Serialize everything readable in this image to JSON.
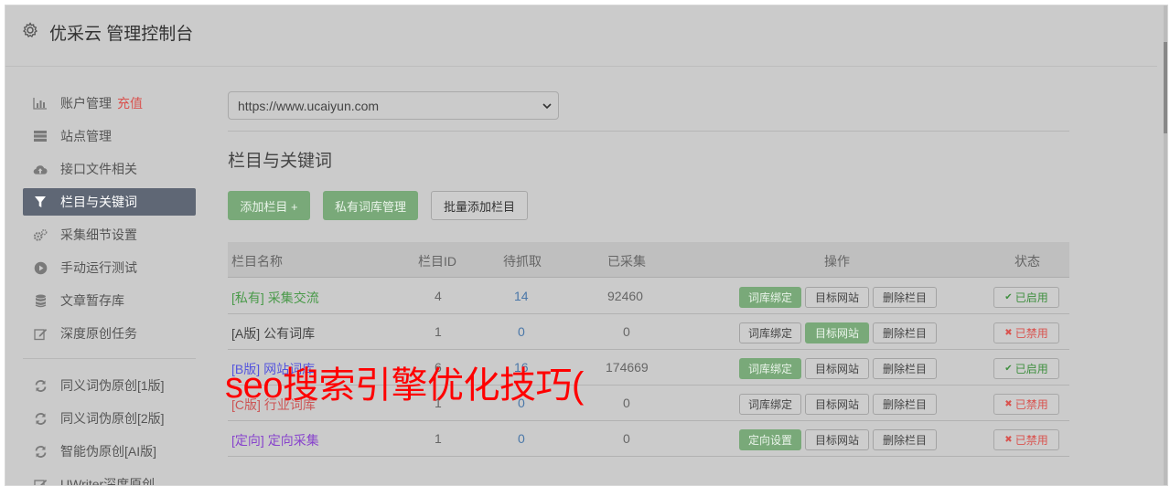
{
  "header": {
    "title": "优采云 管理控制台",
    "icon": "gear-icon"
  },
  "sidebar": {
    "items": [
      {
        "label": "账户管理",
        "extra": "充值",
        "icon": "bar-chart-icon"
      },
      {
        "label": "站点管理",
        "icon": "server-icon"
      },
      {
        "label": "接口文件相关",
        "icon": "cloud-upload-icon"
      },
      {
        "label": "栏目与关键词",
        "icon": "filter-icon",
        "active": true
      },
      {
        "label": "采集细节设置",
        "icon": "cogs-icon"
      },
      {
        "label": "手动运行测试",
        "icon": "play-circle-icon"
      },
      {
        "label": "文章暂存库",
        "icon": "database-icon"
      },
      {
        "label": "深度原创任务",
        "icon": "edit-icon"
      },
      {
        "label": "同义词伪原创[1版]",
        "icon": "refresh-icon"
      },
      {
        "label": "同义词伪原创[2版]",
        "icon": "refresh-icon"
      },
      {
        "label": "智能伪原创[AI版]",
        "icon": "refresh-icon"
      },
      {
        "label": "UWriter深度原创",
        "icon": "edit-icon"
      }
    ]
  },
  "site_select": {
    "value": "https://www.ucaiyun.com"
  },
  "section": {
    "title": "栏目与关键词"
  },
  "toolbar": {
    "add_column": "添加栏目 +",
    "private_lib": "私有词库管理",
    "batch_add": "批量添加栏目"
  },
  "table": {
    "headers": [
      "栏目名称",
      "栏目ID",
      "待抓取",
      "已采集",
      "操作",
      "状态"
    ],
    "rows": [
      {
        "tag": "[私有]",
        "name": "采集交流",
        "tag_color": "#4a9a4a",
        "id": "4",
        "pending": "14",
        "collected": "92460",
        "btn1": "词库绑定",
        "btn1_green": true,
        "btn2": "目标网站",
        "btn2_green": false,
        "btn3": "删除栏目",
        "status": "已启用",
        "status_on": true
      },
      {
        "tag": "[A版]",
        "name": "公有词库",
        "tag_color": "#444444",
        "id": "1",
        "pending": "0",
        "collected": "0",
        "btn1": "词库绑定",
        "btn1_green": false,
        "btn2": "目标网站",
        "btn2_green": true,
        "btn3": "删除栏目",
        "status": "已禁用",
        "status_on": false
      },
      {
        "tag": "[B版]",
        "name": "网站词库",
        "tag_color": "#5555dd",
        "id": "6",
        "pending": "16",
        "collected": "174669",
        "btn1": "词库绑定",
        "btn1_green": true,
        "btn2": "目标网站",
        "btn2_green": false,
        "btn3": "删除栏目",
        "status": "已启用",
        "status_on": true
      },
      {
        "tag": "[C版]",
        "name": "行业词库",
        "tag_color": "#cc5555",
        "id": "1",
        "pending": "0",
        "collected": "0",
        "btn1": "词库绑定",
        "btn1_green": false,
        "btn2": "目标网站",
        "btn2_green": false,
        "btn3": "删除栏目",
        "status": "已禁用",
        "status_on": false
      },
      {
        "tag": "[定向]",
        "name": "定向采集",
        "tag_color": "#8844cc",
        "id": "1",
        "pending": "0",
        "collected": "0",
        "btn1": "定向设置",
        "btn1_green": true,
        "btn2": "目标网站",
        "btn2_green": false,
        "btn3": "删除栏目",
        "status": "已禁用",
        "status_on": false
      }
    ]
  },
  "overlay": {
    "text": "seo搜索引擎优化技巧("
  },
  "colors": {
    "green": "#79a979",
    "on": "#3f8f3f",
    "off": "#d9534f",
    "id_blue": "#4a77a8"
  }
}
